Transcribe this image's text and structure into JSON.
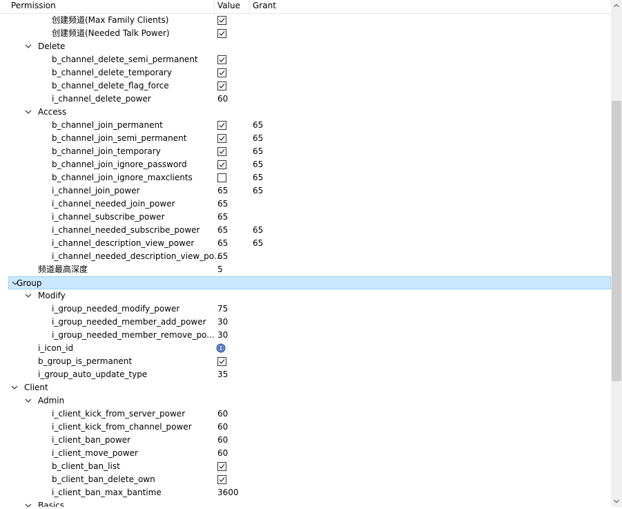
{
  "header": {
    "col_permission": "Permission",
    "col_value": "Value",
    "col_grant": "Grant"
  },
  "rows": [
    {
      "label": "创建频道(Max Family Clients)",
      "level": 2,
      "expander": false,
      "value_type": "check",
      "checked": true,
      "grant": ""
    },
    {
      "label": "创建频道(Needed Talk Power)",
      "level": 2,
      "expander": false,
      "value_type": "check",
      "checked": true,
      "grant": ""
    },
    {
      "label": "Delete",
      "level": 1,
      "expander": true,
      "value_type": "none",
      "grant": ""
    },
    {
      "label": "b_channel_delete_semi_permanent",
      "level": 2,
      "expander": false,
      "value_type": "check",
      "checked": true,
      "grant": ""
    },
    {
      "label": "b_channel_delete_temporary",
      "level": 2,
      "expander": false,
      "value_type": "check",
      "checked": true,
      "grant": ""
    },
    {
      "label": "b_channel_delete_flag_force",
      "level": 2,
      "expander": false,
      "value_type": "check",
      "checked": true,
      "grant": ""
    },
    {
      "label": "i_channel_delete_power",
      "level": 2,
      "expander": false,
      "value_type": "text",
      "value": "60",
      "grant": ""
    },
    {
      "label": "Access",
      "level": 1,
      "expander": true,
      "value_type": "none",
      "grant": ""
    },
    {
      "label": "b_channel_join_permanent",
      "level": 2,
      "expander": false,
      "value_type": "check",
      "checked": true,
      "grant": "65"
    },
    {
      "label": "b_channel_join_semi_permanent",
      "level": 2,
      "expander": false,
      "value_type": "check",
      "checked": true,
      "grant": "65"
    },
    {
      "label": "b_channel_join_temporary",
      "level": 2,
      "expander": false,
      "value_type": "check",
      "checked": true,
      "grant": "65"
    },
    {
      "label": "b_channel_join_ignore_password",
      "level": 2,
      "expander": false,
      "value_type": "check",
      "checked": true,
      "grant": "65"
    },
    {
      "label": "b_channel_join_ignore_maxclients",
      "level": 2,
      "expander": false,
      "value_type": "check",
      "checked": false,
      "grant": "65"
    },
    {
      "label": "i_channel_join_power",
      "level": 2,
      "expander": false,
      "value_type": "text",
      "value": "65",
      "grant": "65"
    },
    {
      "label": "i_channel_needed_join_power",
      "level": 2,
      "expander": false,
      "value_type": "text",
      "value": "65",
      "grant": ""
    },
    {
      "label": "i_channel_subscribe_power",
      "level": 2,
      "expander": false,
      "value_type": "text",
      "value": "65",
      "grant": ""
    },
    {
      "label": "i_channel_needed_subscribe_power",
      "level": 2,
      "expander": false,
      "value_type": "text",
      "value": "65",
      "grant": "65"
    },
    {
      "label": "i_channel_description_view_power",
      "level": 2,
      "expander": false,
      "value_type": "text",
      "value": "65",
      "grant": "65"
    },
    {
      "label": "i_channel_needed_description_view_po...",
      "level": 2,
      "expander": false,
      "value_type": "text",
      "value": "65",
      "grant": ""
    },
    {
      "label": "频道最高深度",
      "level": 1,
      "expander": false,
      "value_type": "text",
      "value": "5",
      "grant": ""
    },
    {
      "label": "Group",
      "level": 0,
      "expander": true,
      "value_type": "none",
      "grant": "",
      "selected": true
    },
    {
      "label": "Modify",
      "level": 1,
      "expander": true,
      "value_type": "none",
      "grant": ""
    },
    {
      "label": "i_group_needed_modify_power",
      "level": 2,
      "expander": false,
      "value_type": "text",
      "value": "75",
      "grant": ""
    },
    {
      "label": "i_group_needed_member_add_power",
      "level": 2,
      "expander": false,
      "value_type": "text",
      "value": "30",
      "grant": ""
    },
    {
      "label": "i_group_needed_member_remove_po...",
      "level": 2,
      "expander": false,
      "value_type": "text",
      "value": "30",
      "grant": ""
    },
    {
      "label": "i_icon_id",
      "level": 1,
      "expander": false,
      "value_type": "icon",
      "icon": "group-icon",
      "grant": ""
    },
    {
      "label": "b_group_is_permanent",
      "level": 1,
      "expander": false,
      "value_type": "check",
      "checked": true,
      "grant": ""
    },
    {
      "label": "i_group_auto_update_type",
      "level": 1,
      "expander": false,
      "value_type": "text",
      "value": "35",
      "grant": ""
    },
    {
      "label": "Client",
      "level": 0,
      "expander": true,
      "value_type": "none",
      "grant": ""
    },
    {
      "label": "Admin",
      "level": 1,
      "expander": true,
      "value_type": "none",
      "grant": ""
    },
    {
      "label": "i_client_kick_from_server_power",
      "level": 2,
      "expander": false,
      "value_type": "text",
      "value": "60",
      "grant": ""
    },
    {
      "label": "i_client_kick_from_channel_power",
      "level": 2,
      "expander": false,
      "value_type": "text",
      "value": "60",
      "grant": ""
    },
    {
      "label": "i_client_ban_power",
      "level": 2,
      "expander": false,
      "value_type": "text",
      "value": "60",
      "grant": ""
    },
    {
      "label": "i_client_move_power",
      "level": 2,
      "expander": false,
      "value_type": "text",
      "value": "60",
      "grant": ""
    },
    {
      "label": "b_client_ban_list",
      "level": 2,
      "expander": false,
      "value_type": "check",
      "checked": true,
      "grant": ""
    },
    {
      "label": "b_client_ban_delete_own",
      "level": 2,
      "expander": false,
      "value_type": "check",
      "checked": true,
      "grant": ""
    },
    {
      "label": "i_client_ban_max_bantime",
      "level": 2,
      "expander": false,
      "value_type": "text",
      "value": "3600",
      "grant": ""
    },
    {
      "label": "Basics",
      "level": 1,
      "expander": true,
      "value_type": "none",
      "grant": ""
    }
  ],
  "colors": {
    "selected_bg": "#cce8ff",
    "selected_border": "#99d1ff",
    "scroll_track": "#f0f0f0",
    "scroll_thumb": "#cdcdcd"
  },
  "icons": {
    "expander": "chevron-down-icon",
    "check": "checkmark-icon",
    "scroll_up": "arrow-up-icon",
    "scroll_down": "arrow-down-icon"
  }
}
